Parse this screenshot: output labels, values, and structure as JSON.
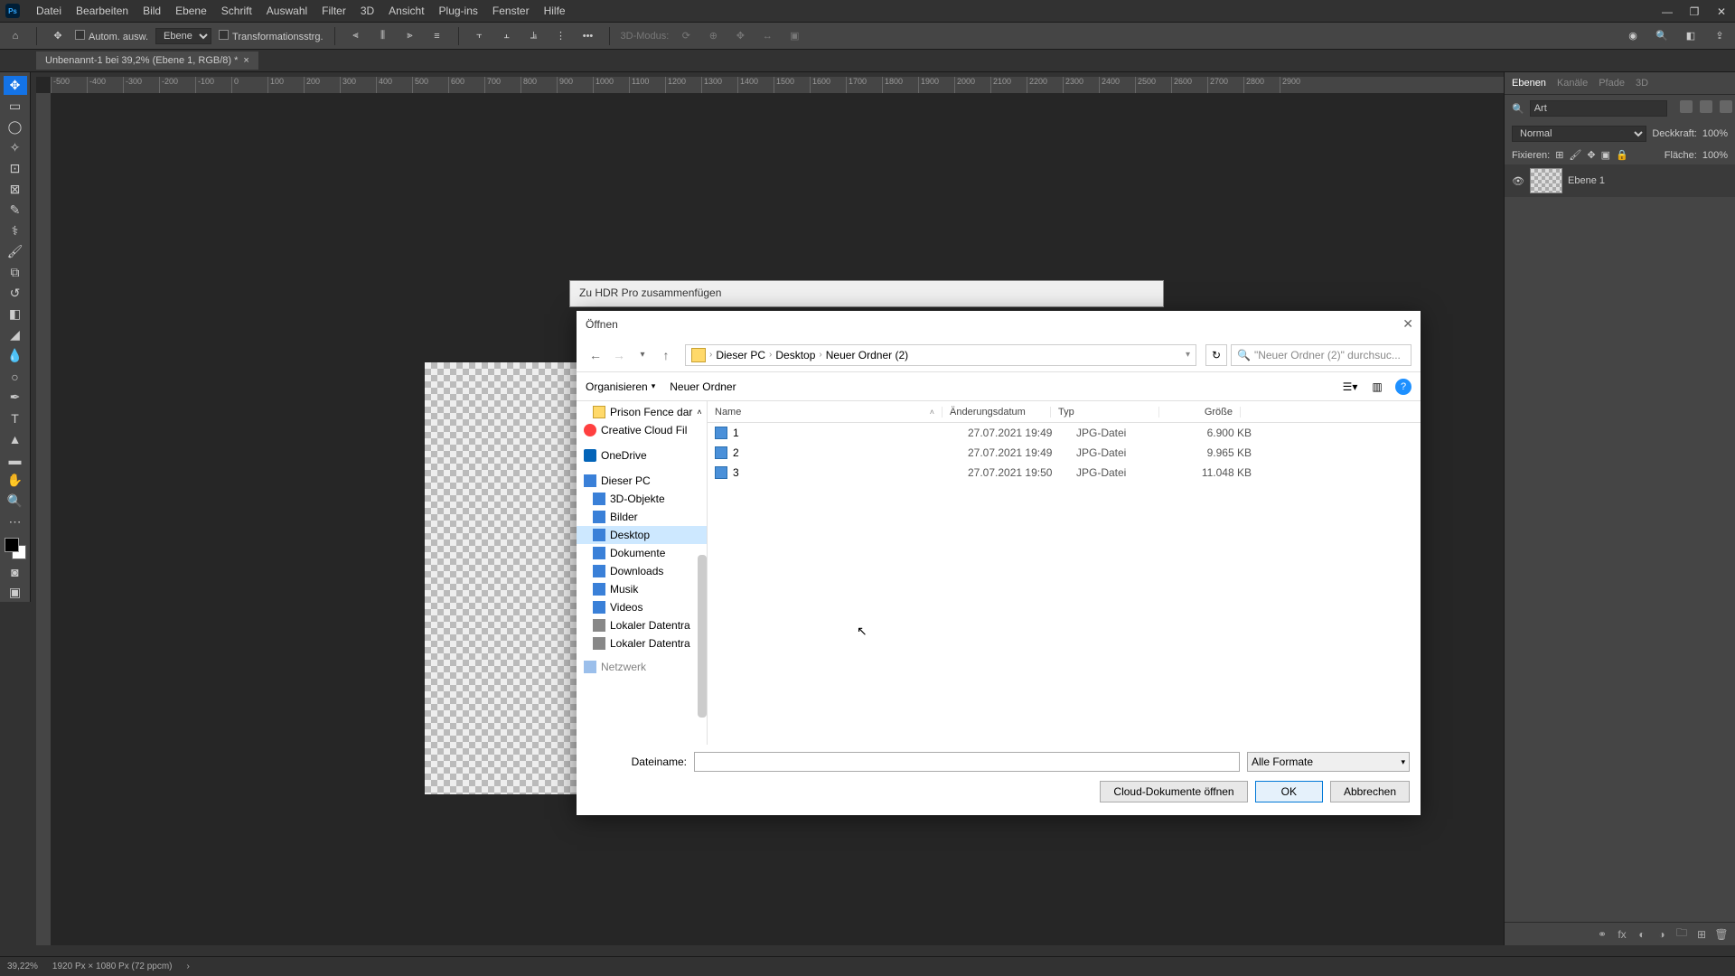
{
  "menubar": {
    "items": [
      "Datei",
      "Bearbeiten",
      "Bild",
      "Ebene",
      "Schrift",
      "Auswahl",
      "Filter",
      "3D",
      "Ansicht",
      "Plug-ins",
      "Fenster",
      "Hilfe"
    ]
  },
  "optionsbar": {
    "auto_select": "Autom. ausw.",
    "layer_mode": "Ebene",
    "transform": "Transformationsstrg.",
    "threed_mode": "3D-Modus:"
  },
  "tab": {
    "title": "Unbenannt-1 bei 39,2% (Ebene 1, RGB/8) *"
  },
  "ruler_marks": [
    "-500",
    "-400",
    "-300",
    "-200",
    "-100",
    "0",
    "100",
    "200",
    "300",
    "400",
    "500",
    "600",
    "700",
    "800",
    "900",
    "1000",
    "1100",
    "1200",
    "1300",
    "1400",
    "1500",
    "1600",
    "1700",
    "1800",
    "1900",
    "2000",
    "2100",
    "2200",
    "2300",
    "2400",
    "2500",
    "2600",
    "2700",
    "2800",
    "2900"
  ],
  "statusbar": {
    "zoom": "39,22%",
    "docinfo": "1920 Px × 1080 Px (72 ppcm)"
  },
  "layers_panel": {
    "tabs": [
      "Ebenen",
      "Kanäle",
      "Pfade",
      "3D"
    ],
    "search_placeholder": "Art",
    "blend_mode": "Normal",
    "opacity_label": "Deckkraft:",
    "opacity_value": "100%",
    "fix_label": "Fixieren:",
    "fill_label": "Fläche:",
    "fill_value": "100%",
    "layer_name": "Ebene 1"
  },
  "hdr_dialog": {
    "title": "Zu HDR Pro zusammenfügen"
  },
  "open_dialog": {
    "title": "Öffnen",
    "breadcrumb": [
      "Dieser PC",
      "Desktop",
      "Neuer Ordner (2)"
    ],
    "search_placeholder": "\"Neuer Ordner (2)\" durchsuc...",
    "organize": "Organisieren",
    "new_folder": "Neuer Ordner",
    "tree": [
      {
        "label": "Prison Fence dar",
        "icon": "folder",
        "lvl": 2
      },
      {
        "label": "Creative Cloud Fil",
        "icon": "cloud",
        "lvl": 1
      },
      {
        "label": "OneDrive",
        "icon": "onedrive",
        "lvl": 1
      },
      {
        "label": "Dieser PC",
        "icon": "pc",
        "lvl": 1
      },
      {
        "label": "3D-Objekte",
        "icon": "blue",
        "lvl": 2
      },
      {
        "label": "Bilder",
        "icon": "blue",
        "lvl": 2
      },
      {
        "label": "Desktop",
        "icon": "blue",
        "lvl": 2,
        "selected": true
      },
      {
        "label": "Dokumente",
        "icon": "blue",
        "lvl": 2
      },
      {
        "label": "Downloads",
        "icon": "blue",
        "lvl": 2
      },
      {
        "label": "Musik",
        "icon": "blue",
        "lvl": 2
      },
      {
        "label": "Videos",
        "icon": "blue",
        "lvl": 2
      },
      {
        "label": "Lokaler Datentra",
        "icon": "disk",
        "lvl": 2
      },
      {
        "label": "Lokaler Datentra",
        "icon": "disk",
        "lvl": 2
      },
      {
        "label": "Netzwerk",
        "icon": "pc",
        "lvl": 1
      }
    ],
    "columns": {
      "name": "Name",
      "date": "Änderungsdatum",
      "type": "Typ",
      "size": "Größe"
    },
    "files": [
      {
        "name": "1",
        "date": "27.07.2021 19:49",
        "type": "JPG-Datei",
        "size": "6.900 KB"
      },
      {
        "name": "2",
        "date": "27.07.2021 19:49",
        "type": "JPG-Datei",
        "size": "9.965 KB"
      },
      {
        "name": "3",
        "date": "27.07.2021 19:50",
        "type": "JPG-Datei",
        "size": "11.048 KB"
      }
    ],
    "filename_label": "Dateiname:",
    "format_label": "Alle Formate",
    "cloud_btn": "Cloud-Dokumente öffnen",
    "ok_btn": "OK",
    "cancel_btn": "Abbrechen"
  }
}
